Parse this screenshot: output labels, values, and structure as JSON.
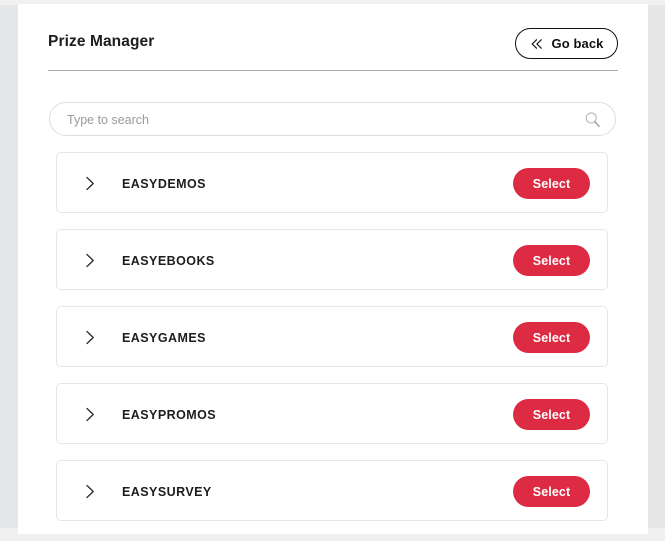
{
  "header": {
    "title": "Prize Manager",
    "go_back_label": "Go back",
    "go_back_icon": "double-chevron-left-icon"
  },
  "search": {
    "placeholder": "Type to search",
    "value": "",
    "icon": "search-icon"
  },
  "list": {
    "row_chevron_icon": "chevron-right-icon",
    "items": [
      {
        "label": "EASYDEMOS",
        "action_label": "Select"
      },
      {
        "label": "EASYEBOOKS",
        "action_label": "Select"
      },
      {
        "label": "EASYGAMES",
        "action_label": "Select"
      },
      {
        "label": "EASYPROMOS",
        "action_label": "Select"
      },
      {
        "label": "EASYSURVEY",
        "action_label": "Select"
      }
    ]
  },
  "colors": {
    "accent_red": "#dc2b43",
    "text_primary": "#1d1d1f",
    "placeholder": "#9a9a9f",
    "border_light": "#e7e7ea",
    "page_backdrop": "#e6e7e8"
  }
}
